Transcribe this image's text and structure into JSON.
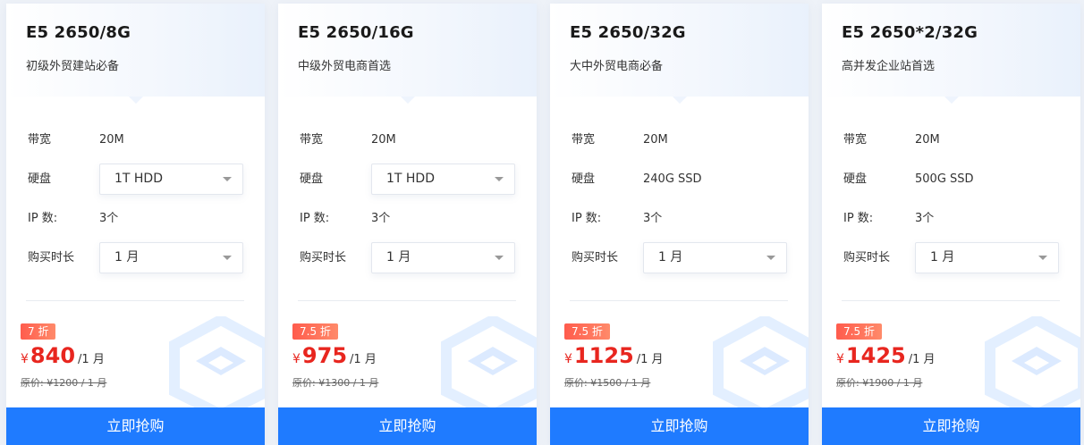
{
  "labels": {
    "bandwidth": "带宽",
    "disk": "硬盘",
    "ip": "IP 数:",
    "duration": "购买时长",
    "buy_button": "立即抢购",
    "currency": "¥",
    "price_unit": "/1 月"
  },
  "colors": {
    "primary": "#1f7bff",
    "price": "#e8261f",
    "badge": "#ff5c4d"
  },
  "icons": {
    "watermark": "hexagon-logo-icon",
    "dropdown": "caret-down-icon"
  },
  "plans": [
    {
      "title": "E5 2650/8G",
      "subtitle": "初级外贸建站必备",
      "bandwidth": "20M",
      "disk": "1T HDD",
      "disk_is_select": true,
      "ip_count": "3个",
      "duration": "1 月",
      "discount": "7 折",
      "price": "840",
      "original_price": "原价: ¥1200 / 1 月"
    },
    {
      "title": "E5 2650/16G",
      "subtitle": "中级外贸电商首选",
      "bandwidth": "20M",
      "disk": "1T HDD",
      "disk_is_select": true,
      "ip_count": "3个",
      "duration": "1 月",
      "discount": "7.5 折",
      "price": "975",
      "original_price": "原价: ¥1300 / 1 月"
    },
    {
      "title": "E5 2650/32G",
      "subtitle": "大中外贸电商必备",
      "bandwidth": "20M",
      "disk": "240G SSD",
      "disk_is_select": false,
      "ip_count": "3个",
      "duration": "1 月",
      "discount": "7.5 折",
      "price": "1125",
      "original_price": "原价: ¥1500 / 1 月"
    },
    {
      "title": "E5 2650*2/32G",
      "subtitle": "高并发企业站首选",
      "bandwidth": "20M",
      "disk": "500G SSD",
      "disk_is_select": false,
      "ip_count": "3个",
      "duration": "1 月",
      "discount": "7.5 折",
      "price": "1425",
      "original_price": "原价: ¥1900 / 1 月"
    }
  ]
}
